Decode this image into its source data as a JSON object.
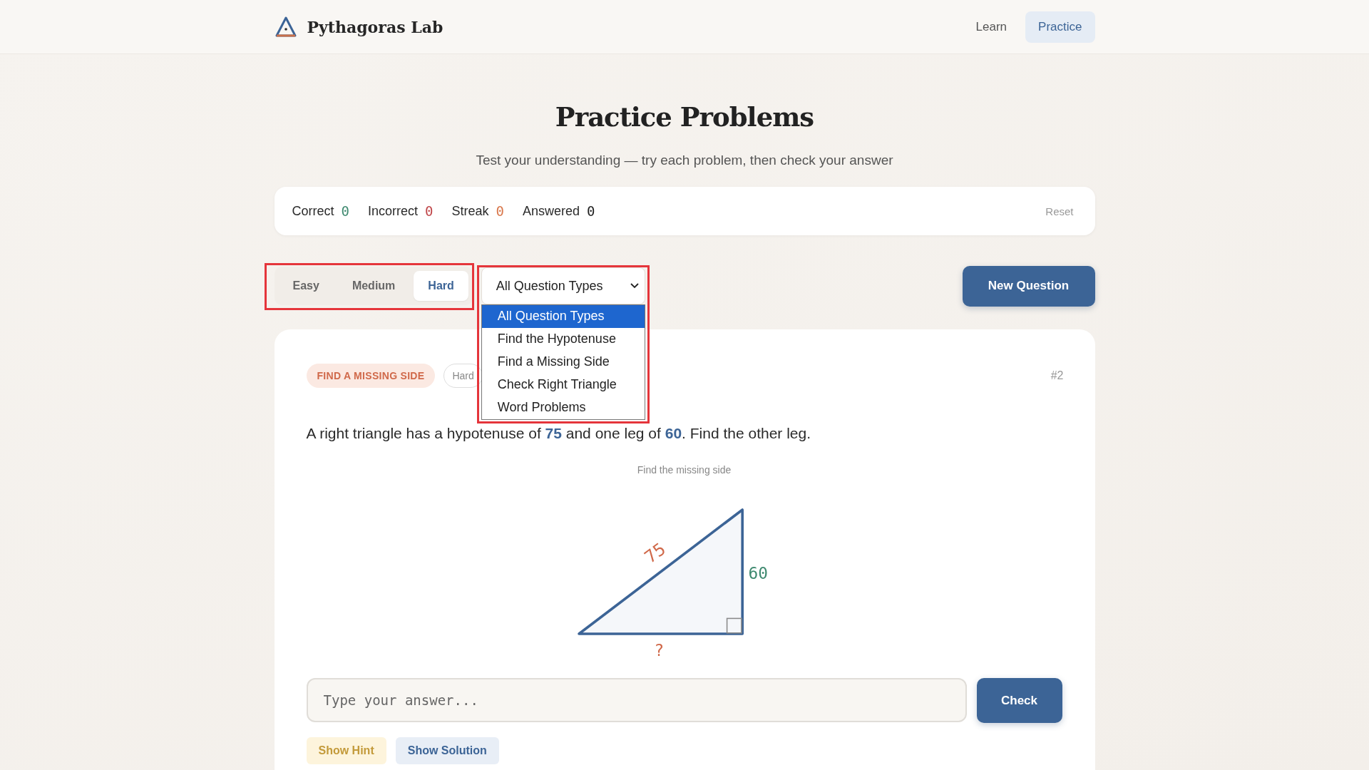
{
  "header": {
    "brand": "Pythagoras Lab",
    "nav": [
      {
        "label": "Learn",
        "selected": false
      },
      {
        "label": "Practice",
        "selected": true
      }
    ]
  },
  "page": {
    "title": "Practice Problems",
    "subtitle": "Test your understanding — try each problem, then check your answer"
  },
  "stats": {
    "items": [
      {
        "label": "Correct",
        "value": "0",
        "color": "#3f8a70"
      },
      {
        "label": "Incorrect",
        "value": "0",
        "color": "#c0474a"
      },
      {
        "label": "Streak",
        "value": "0",
        "color": "#d9774b"
      },
      {
        "label": "Answered",
        "value": "0",
        "color": "#222222"
      }
    ],
    "reset": "Reset"
  },
  "difficulty": {
    "highlighted": true,
    "options": [
      {
        "label": "Easy",
        "selected": false
      },
      {
        "label": "Medium",
        "selected": false
      },
      {
        "label": "Hard",
        "selected": true
      }
    ]
  },
  "type_select": {
    "value": "All Question Types",
    "expanded": true,
    "highlighted": true,
    "options": [
      {
        "label": "All Question Types",
        "selected": true
      },
      {
        "label": "Find the Hypotenuse",
        "selected": false
      },
      {
        "label": "Find a Missing Side",
        "selected": false
      },
      {
        "label": "Check Right Triangle",
        "selected": false
      },
      {
        "label": "Word Problems",
        "selected": false
      }
    ]
  },
  "new_question": "New Question",
  "problem": {
    "type_tag": "FIND A MISSING SIDE",
    "difficulty_tag": "Hard",
    "number": "#2",
    "question": "A right triangle has a hypotenuse of **75** and one leg of **60**. Find the other leg.",
    "diagram": {
      "caption": "Find the missing side",
      "hypotenuse": "75",
      "leg": "60",
      "unknown": "?"
    }
  },
  "answer": {
    "placeholder": "Type your answer...",
    "check": "Check"
  },
  "actions": [
    {
      "label": "Show Hint",
      "kind": "hint"
    },
    {
      "label": "Show Solution",
      "kind": "solution"
    }
  ]
}
